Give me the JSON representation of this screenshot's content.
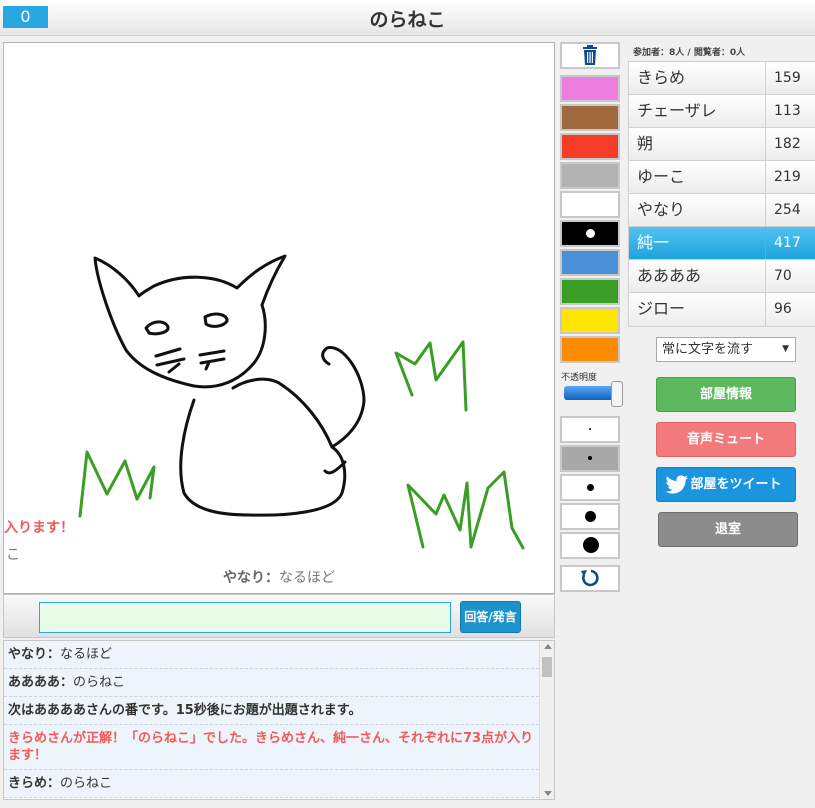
{
  "header": {
    "counter": "0",
    "title": "のらねこ"
  },
  "canvas": {
    "flow_text_1": "入ります！",
    "flow_text_2": "こ",
    "last_message": {
      "name": "やなり：",
      "text": "なるほど"
    }
  },
  "input": {
    "value": "",
    "answer_label": "回答/発言"
  },
  "chat": [
    {
      "name": "やなり：",
      "text": "なるほど"
    },
    {
      "name": "ああああ：",
      "text": "のらねこ"
    },
    {
      "system": "次はああああさんの番です。15秒後にお題が出題されます。"
    },
    {
      "correct": "きらめさんが正解！「のらねこ」でした。きらめさん、純一さん、それぞれに73点が入ります！"
    },
    {
      "name": "きらめ：",
      "text": "のらねこ"
    }
  ],
  "palette": {
    "colors": [
      "#ee7de0",
      "#a06a3e",
      "#f53d27",
      "#b3b3b3",
      "#ffffff",
      "#000000",
      "#4a90d9",
      "#3a9e24",
      "#ffe500",
      "#ff8c00"
    ],
    "opacity_label": "不透明度",
    "opacity_value": 1.0
  },
  "room": {
    "counts": "参加者：8人 / 閲覧者：0人",
    "players": [
      {
        "name": "きらめ",
        "score": "159"
      },
      {
        "name": "チェーザレ",
        "score": "113"
      },
      {
        "name": "朔",
        "score": "182"
      },
      {
        "name": "ゆーこ",
        "score": "219"
      },
      {
        "name": "やなり",
        "score": "254"
      },
      {
        "name": "純一",
        "score": "417"
      },
      {
        "name": "ああああ",
        "score": "70"
      },
      {
        "name": "ジロー",
        "score": "96"
      }
    ],
    "flow_select": "常に文字を流す"
  },
  "buttons": {
    "room_info": "部屋情報",
    "mute": "音声ミュート",
    "tweet": "部屋をツイート",
    "exit": "退室"
  }
}
